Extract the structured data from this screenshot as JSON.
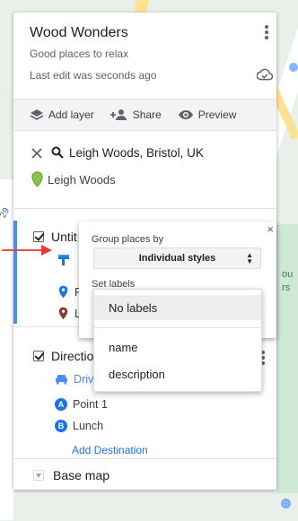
{
  "map": {
    "side_text": [
      "ou",
      "rs"
    ],
    "left_label": "29"
  },
  "header": {
    "title": "Wood Wonders",
    "subtitle": "Good places to relax",
    "last_edit": "Last edit was seconds ago"
  },
  "toolbar": {
    "add_layer": "Add layer",
    "share": "Share",
    "preview": "Preview"
  },
  "search": {
    "query": "Leigh Woods, Bristol, UK",
    "result": "Leigh Woods"
  },
  "layer1": {
    "title": "Untit",
    "places": [
      "P",
      "L"
    ]
  },
  "layer2": {
    "title": "Directio",
    "mode": "Drivi",
    "points": [
      {
        "badge": "A",
        "label": "Point 1"
      },
      {
        "badge": "B",
        "label": "Lunch"
      }
    ],
    "add_destination": "Add Destination"
  },
  "basemap": {
    "label": "Base map"
  },
  "popup": {
    "close": "×",
    "group_label": "Group places by",
    "group_value": "Individual styles",
    "set_labels": "Set labels"
  },
  "dropdown": {
    "options": [
      "No labels",
      "name",
      "description"
    ],
    "selected": "No labels"
  },
  "colors": {
    "accent": "#4c8bf5",
    "link": "#1a73e8",
    "arrow": "#e53935",
    "pin_green": "#7cb342"
  }
}
